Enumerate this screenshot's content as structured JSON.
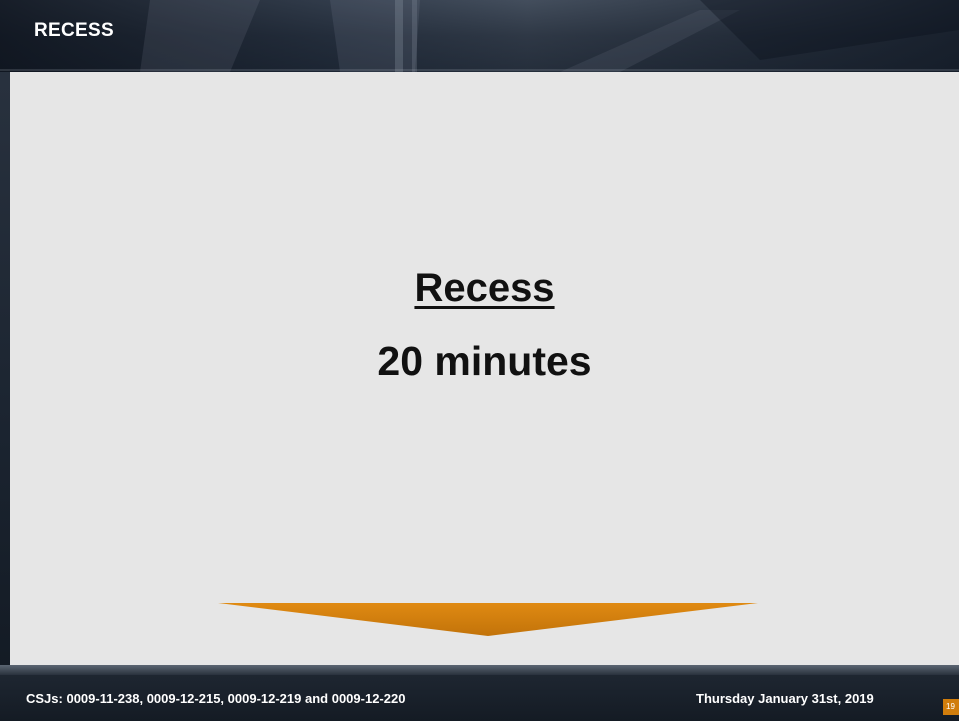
{
  "header": {
    "title": "RECESS"
  },
  "content": {
    "title": "Recess",
    "subtitle": "20 minutes"
  },
  "footer": {
    "csj_text": "CSJs: 0009-11-238, 0009-12-215, 0009-12-219 and 0009-12-220",
    "date_text": "Thursday January 31st, 2019",
    "page_number": "19"
  },
  "colors": {
    "accent": "#d07d0c",
    "panel": "#e6e6e6",
    "header": "#2a3340"
  },
  "icons": {
    "arrow": "down-arrow-icon"
  }
}
